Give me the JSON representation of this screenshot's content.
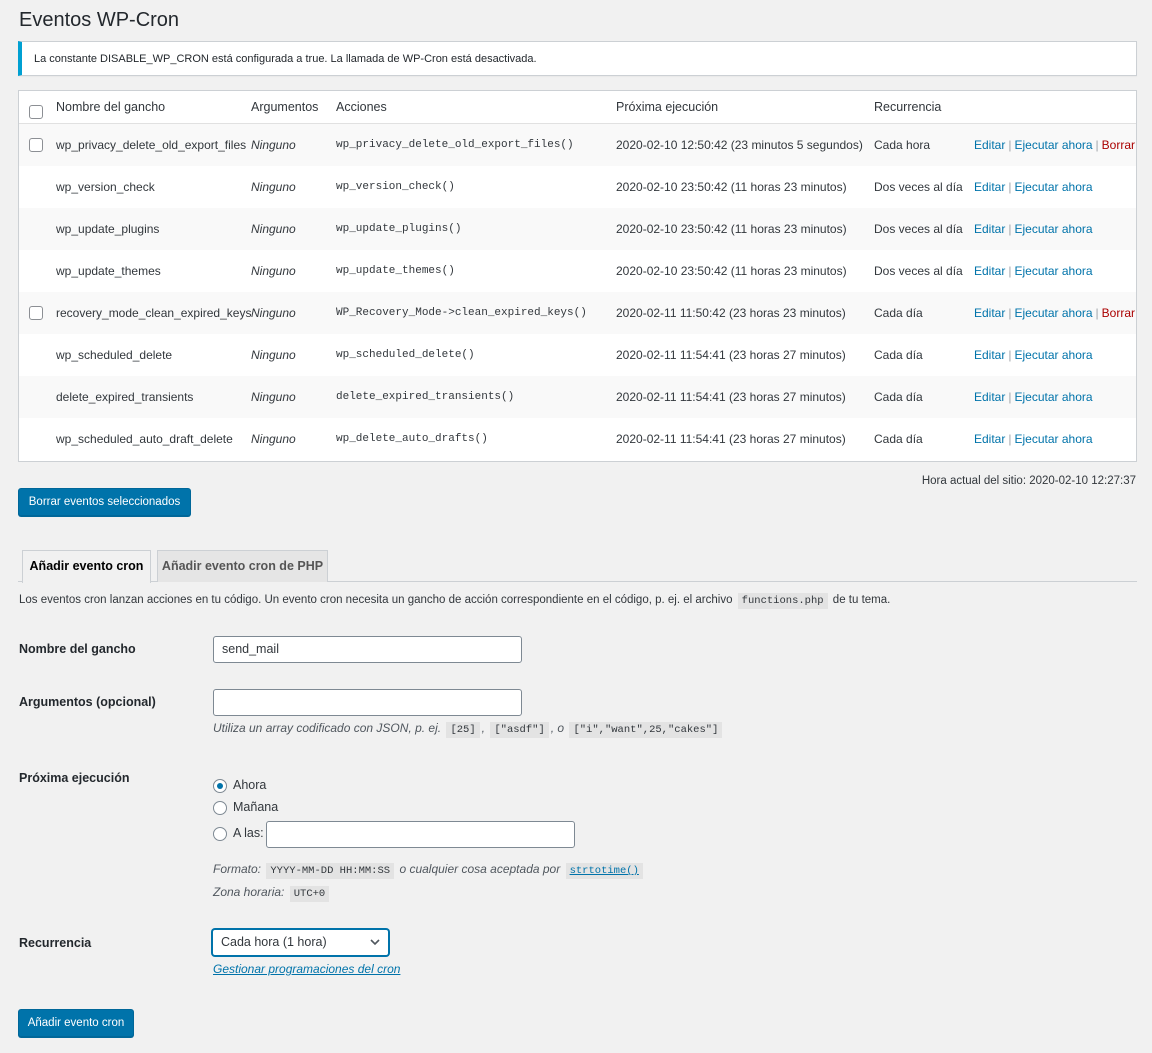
{
  "page": {
    "title": "Eventos WP-Cron",
    "notice": "La constante DISABLE_WP_CRON está configurada a true. La llamada de WP-Cron está desactivada."
  },
  "table": {
    "headers": {
      "hook": "Nombre del gancho",
      "args": "Argumentos",
      "actions": "Acciones",
      "next": "Próxima ejecución",
      "recurrence": "Recurrencia"
    },
    "link_edit": "Editar",
    "link_run": "Ejecutar ahora",
    "link_delete": "Borrar",
    "rows": [
      {
        "hook": "wp_privacy_delete_old_export_files",
        "args": "Ninguno",
        "action": "wp_privacy_delete_old_export_files()",
        "next": "2020-02-10 12:50:42 (23 minutos 5 segundos)",
        "recurrence": "Cada hora"
      },
      {
        "hook": "wp_version_check",
        "args": "Ninguno",
        "action": "wp_version_check()",
        "next": "2020-02-10 23:50:42 (11 horas 23 minutos)",
        "recurrence": "Dos veces al día"
      },
      {
        "hook": "wp_update_plugins",
        "args": "Ninguno",
        "action": "wp_update_plugins()",
        "next": "2020-02-10 23:50:42 (11 horas 23 minutos)",
        "recurrence": "Dos veces al día"
      },
      {
        "hook": "wp_update_themes",
        "args": "Ninguno",
        "action": "wp_update_themes()",
        "next": "2020-02-10 23:50:42 (11 horas 23 minutos)",
        "recurrence": "Dos veces al día"
      },
      {
        "hook": "recovery_mode_clean_expired_keys",
        "args": "Ninguno",
        "action": "WP_Recovery_Mode->clean_expired_keys()",
        "next": "2020-02-11 11:50:42 (23 horas 23 minutos)",
        "recurrence": "Cada día"
      },
      {
        "hook": "wp_scheduled_delete",
        "args": "Ninguno",
        "action": "wp_scheduled_delete()",
        "next": "2020-02-11 11:54:41 (23 horas 27 minutos)",
        "recurrence": "Cada día"
      },
      {
        "hook": "delete_expired_transients",
        "args": "Ninguno",
        "action": "delete_expired_transients()",
        "next": "2020-02-11 11:54:41 (23 horas 27 minutos)",
        "recurrence": "Cada día"
      },
      {
        "hook": "wp_scheduled_auto_draft_delete",
        "args": "Ninguno",
        "action": "wp_delete_auto_drafts()",
        "next": "2020-02-11 11:54:41 (23 horas 27 minutos)",
        "recurrence": "Cada día"
      }
    ]
  },
  "site_time": "Hora actual del sitio: 2020-02-10 12:27:37",
  "delete_selected_button": "Borrar eventos seleccionados",
  "tabs": [
    "Añadir evento cron",
    "Añadir evento cron de PHP"
  ],
  "intro": {
    "before": "Los eventos cron lanzan acciones en tu código. Un evento cron necesita un gancho de acción correspondiente en el código, p. ej. el archivo",
    "code": "functions.php",
    "after": "de tu tema."
  },
  "form": {
    "hook_label": "Nombre del gancho",
    "hook_value": "send_mail",
    "args_label": "Argumentos (opcional)",
    "args_value": "",
    "args_hint_prefix": "Utiliza un array codificado con JSON, p. ej.",
    "args_hint_code1": "[25]",
    "args_hint_code2": "[\"asdf\"]",
    "args_hint_sep2": ", o",
    "args_hint_code3": "[\"i\",\"want\",25,\"cakes\"]",
    "next_label": "Próxima ejecución",
    "radio_now": "Ahora",
    "radio_tomorrow": "Mañana",
    "radio_at": "A las:",
    "at_value": "",
    "format_prefix": "Formato:",
    "format_code": "YYYY-MM-DD HH:MM:SS",
    "format_middle": "o cualquier cosa aceptada por",
    "format_link": "strtotime()",
    "timezone_prefix": "Zona horaria:",
    "timezone_code": "UTC+0",
    "recurrence_label": "Recurrencia",
    "recurrence_selected": "Cada hora (1 hora)",
    "manage_link": "Gestionar programaciones del cron",
    "submit": "Añadir evento cron"
  },
  "colors": {
    "accent": "#0073aa",
    "notice_border": "#00a0d2",
    "delete_link": "#aa0000"
  }
}
